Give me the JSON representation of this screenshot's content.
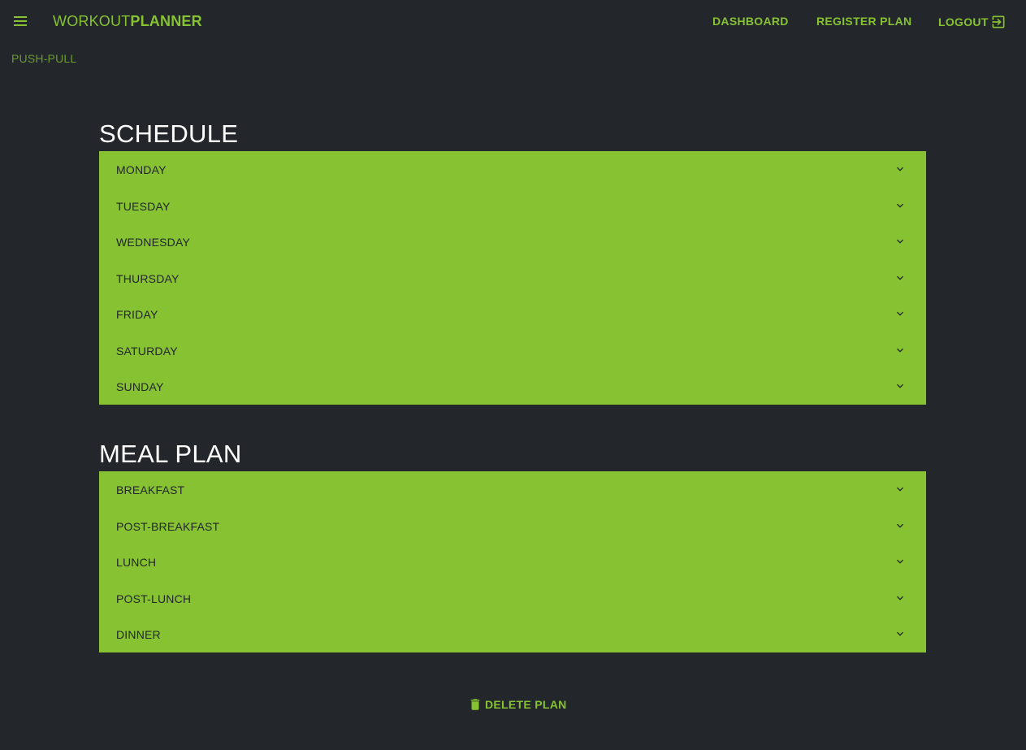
{
  "header": {
    "menu_icon": "menu-icon",
    "brand_light": "WORKOUT",
    "brand_bold": "PLANNER",
    "nav": {
      "dashboard": "DASHBOARD",
      "register": "REGISTER PLAN",
      "logout": "LOGOUT"
    },
    "logout_icon": "logout-icon"
  },
  "breadcrumb": "PUSH-PULL",
  "schedule": {
    "title": "SCHEDULE",
    "days": [
      {
        "label": "MONDAY"
      },
      {
        "label": "TUESDAY"
      },
      {
        "label": "WEDNESDAY"
      },
      {
        "label": "THURSDAY"
      },
      {
        "label": "FRIDAY"
      },
      {
        "label": "SATURDAY"
      },
      {
        "label": "SUNDAY"
      }
    ]
  },
  "meal_plan": {
    "title": "MEAL PLAN",
    "meals": [
      {
        "label": "BREAKFAST"
      },
      {
        "label": "POST-BREAKFAST"
      },
      {
        "label": "LUNCH"
      },
      {
        "label": "POST-LUNCH"
      },
      {
        "label": "DINNER"
      }
    ]
  },
  "actions": {
    "delete_label": "DELETE PLAN",
    "delete_icon": "trash-icon"
  },
  "colors": {
    "background": "#23262b",
    "accent": "#86c232",
    "breadcrumb": "#6b9a2e",
    "panel_text": "#23262b",
    "title": "#ffffff"
  }
}
